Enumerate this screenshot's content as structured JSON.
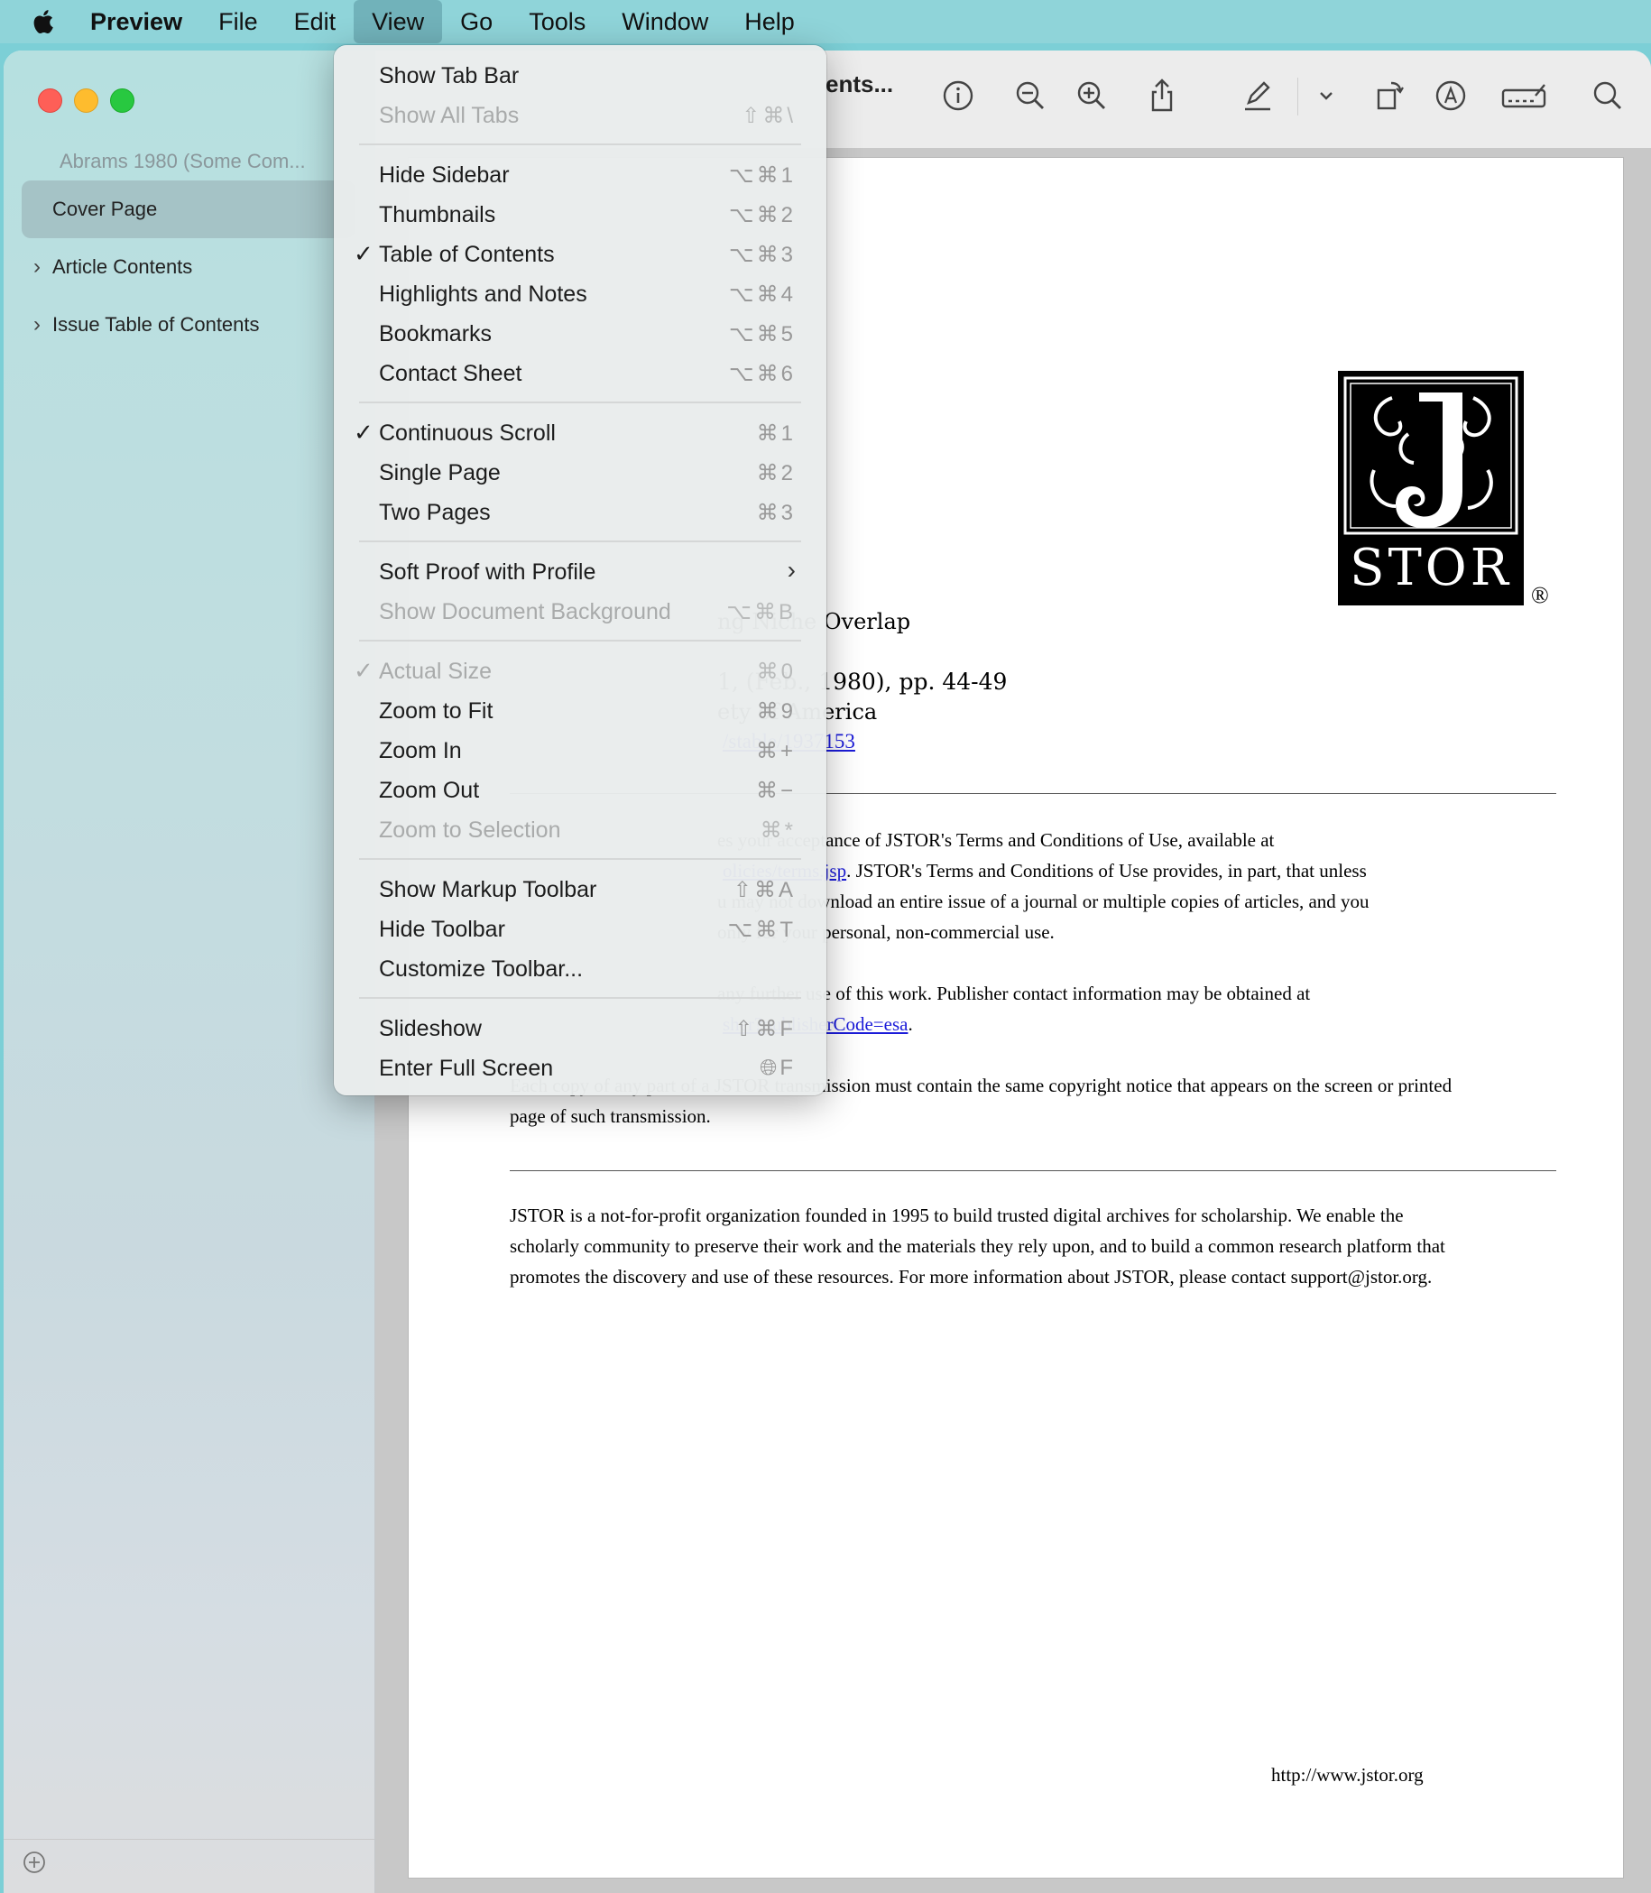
{
  "menubar": {
    "app": "Preview",
    "items": [
      "File",
      "Edit",
      "View",
      "Go",
      "Tools",
      "Window",
      "Help"
    ]
  },
  "sidebar": {
    "doc_title": "Abrams 1980 (Some Com...",
    "items": [
      {
        "label": "Cover Page"
      },
      {
        "label": "Article Contents"
      },
      {
        "label": "Issue Table of Contents"
      }
    ]
  },
  "toolbar": {
    "title_fragment": "ents..."
  },
  "document": {
    "title_fragment": "ng Niche Overlap",
    "citation_fragment": "1, (Feb., 1980), pp. 44-49",
    "publisher_fragment": "ety of America",
    "stable_link": "/stable/1937153",
    "terms_lines": [
      "es your acceptance of JSTOR's Terms and Conditions of Use, available at",
      ". JSTOR's Terms and Conditions of Use provides, in part, that unless",
      "u may not download an entire issue of a journal or multiple copies of articles, and you",
      "only for your personal, non-commercial use."
    ],
    "terms_link": "olicies/terms.jsp",
    "contact_line": "any further use of this work. Publisher contact information may be obtained at",
    "publisher_link": "sher?publisherCode=esa",
    "copy_lines": [
      "Each copy of any part of a JSTOR transmission must contain the same copyright notice that appears on the screen or printed",
      "page of such transmission."
    ],
    "about_lines": [
      "JSTOR is a not-for-profit organization founded in 1995 to build trusted digital archives for scholarship. We enable the",
      "scholarly community to preserve their work and the materials they rely upon, and to build a common research platform that",
      "promotes the discovery and use of these resources. For more information about JSTOR, please contact support@jstor.org."
    ],
    "footer_url": "http://www.jstor.org",
    "logo_text": "STOR",
    "logo_mark": "®"
  },
  "view_menu": {
    "items": [
      {
        "label": "Show Tab Bar",
        "shortcut": "",
        "checked": false,
        "disabled": false
      },
      {
        "label": "Show All Tabs",
        "shortcut": "⇧⌘\\",
        "checked": false,
        "disabled": true
      },
      {
        "label": "Hide Sidebar",
        "shortcut": "⌥⌘1",
        "checked": false,
        "disabled": false
      },
      {
        "label": "Thumbnails",
        "shortcut": "⌥⌘2",
        "checked": false,
        "disabled": false
      },
      {
        "label": "Table of Contents",
        "shortcut": "⌥⌘3",
        "checked": true,
        "disabled": false
      },
      {
        "label": "Highlights and Notes",
        "shortcut": "⌥⌘4",
        "checked": false,
        "disabled": false
      },
      {
        "label": "Bookmarks",
        "shortcut": "⌥⌘5",
        "checked": false,
        "disabled": false
      },
      {
        "label": "Contact Sheet",
        "shortcut": "⌥⌘6",
        "checked": false,
        "disabled": false
      },
      {
        "label": "Continuous Scroll",
        "shortcut": "⌘1",
        "checked": true,
        "disabled": false
      },
      {
        "label": "Single Page",
        "shortcut": "⌘2",
        "checked": false,
        "disabled": false
      },
      {
        "label": "Two Pages",
        "shortcut": "⌘3",
        "checked": false,
        "disabled": false
      },
      {
        "label": "Soft Proof with Profile",
        "shortcut": "",
        "checked": false,
        "disabled": false,
        "submenu": true
      },
      {
        "label": "Show Document Background",
        "shortcut": "⌥⌘B",
        "checked": false,
        "disabled": true
      },
      {
        "label": "Actual Size",
        "shortcut": "⌘0",
        "checked": true,
        "disabled": true
      },
      {
        "label": "Zoom to Fit",
        "shortcut": "⌘9",
        "checked": false,
        "disabled": false
      },
      {
        "label": "Zoom In",
        "shortcut": "⌘+",
        "checked": false,
        "disabled": false
      },
      {
        "label": "Zoom Out",
        "shortcut": "⌘−",
        "checked": false,
        "disabled": false
      },
      {
        "label": "Zoom to Selection",
        "shortcut": "⌘*",
        "checked": false,
        "disabled": true
      },
      {
        "label": "Show Markup Toolbar",
        "shortcut": "⇧⌘A",
        "checked": false,
        "disabled": false
      },
      {
        "label": "Hide Toolbar",
        "shortcut": "⌥⌘T",
        "checked": false,
        "disabled": false
      },
      {
        "label": "Customize Toolbar...",
        "shortcut": "",
        "checked": false,
        "disabled": false
      },
      {
        "label": "Slideshow",
        "shortcut": "⇧⌘F",
        "checked": false,
        "disabled": false
      },
      {
        "label": "Enter Full Screen",
        "shortcut": "🌐︎F",
        "checked": false,
        "disabled": false
      }
    ],
    "check_glyph": "✓",
    "submenu_glyph": "›"
  },
  "icons": {
    "toolbar": [
      "info-icon",
      "zoom-out-icon",
      "zoom-in-icon",
      "share-icon",
      "highlight-pen-icon",
      "chevron-down-icon",
      "rotate-icon",
      "markup-icon",
      "signature-icon",
      "search-icon"
    ]
  },
  "colors": {
    "menubar": "#8fd4d9",
    "close": "#fe5f57",
    "minimize": "#febc2e",
    "maximize": "#28c840",
    "link": "#1b1bd9"
  }
}
